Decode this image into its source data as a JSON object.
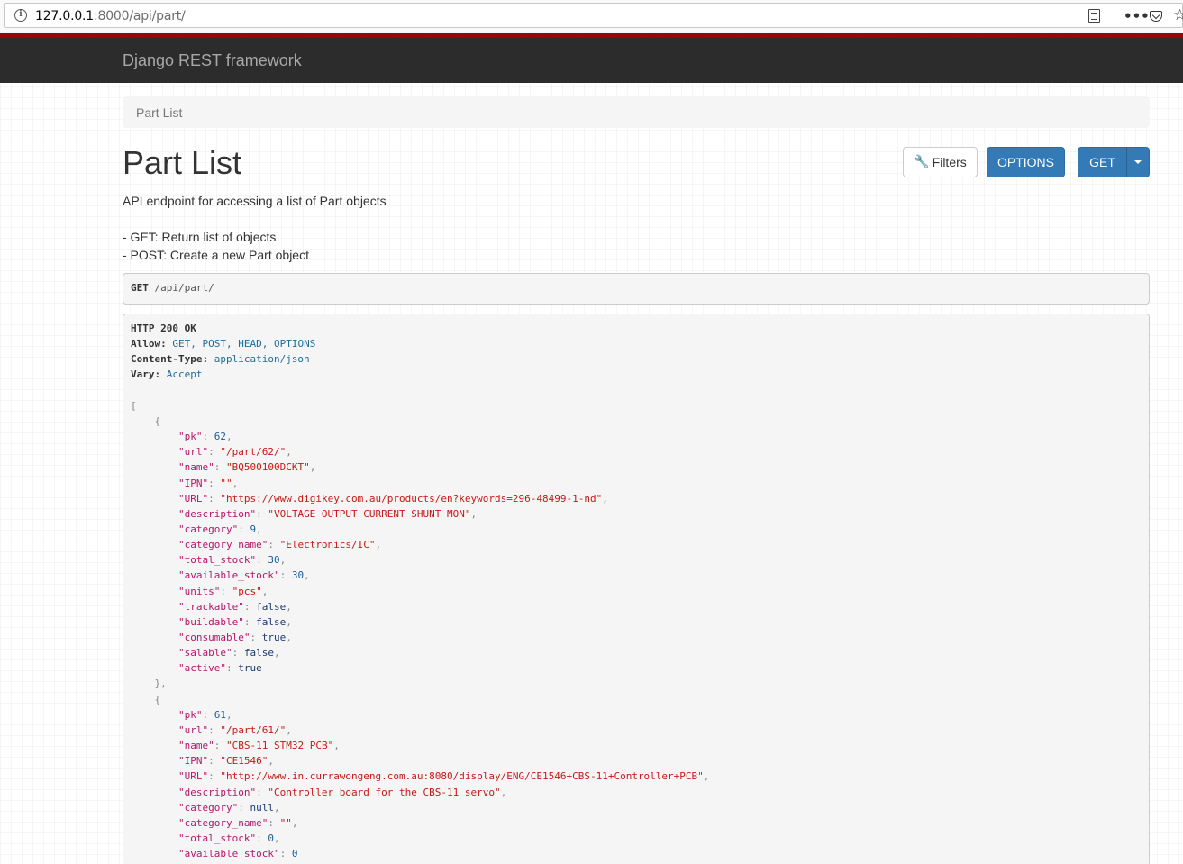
{
  "browser": {
    "url_host": "127.0.0.1",
    "url_path": ":8000/api/part/",
    "icons": [
      "info-icon",
      "reader-view-icon",
      "more-icon",
      "pocket-icon",
      "bookmark-star-icon"
    ]
  },
  "navbar": {
    "brand": "Django REST framework"
  },
  "breadcrumb": {
    "current": "Part List"
  },
  "page": {
    "title": "Part List",
    "description_lines": [
      "API endpoint for accessing a list of Part objects",
      "- GET: Return list of objects",
      "- POST: Create a new Part object"
    ]
  },
  "buttons": {
    "filters": "Filters",
    "options": "OPTIONS",
    "get": "GET"
  },
  "request": {
    "method": "GET",
    "path": "/api/part/"
  },
  "response": {
    "status": "HTTP 200 OK",
    "headers": [
      {
        "key": "Allow",
        "value": "GET, POST, HEAD, OPTIONS"
      },
      {
        "key": "Content-Type",
        "value": "application/json"
      },
      {
        "key": "Vary",
        "value": "Accept"
      }
    ],
    "parts": [
      {
        "fields": [
          {
            "k": "pk",
            "v": "62",
            "t": "num"
          },
          {
            "k": "url",
            "v": "\"/part/62/\"",
            "t": "str"
          },
          {
            "k": "name",
            "v": "\"BQ500100DCKT\"",
            "t": "str"
          },
          {
            "k": "IPN",
            "v": "\"\"",
            "t": "str"
          },
          {
            "k": "URL",
            "v": "\"https://www.digikey.com.au/products/en?keywords=296-48499-1-nd\"",
            "t": "str"
          },
          {
            "k": "description",
            "v": "\"VOLTAGE OUTPUT CURRENT SHUNT MON\"",
            "t": "str"
          },
          {
            "k": "category",
            "v": "9",
            "t": "num"
          },
          {
            "k": "category_name",
            "v": "\"Electronics/IC\"",
            "t": "str"
          },
          {
            "k": "total_stock",
            "v": "30",
            "t": "num"
          },
          {
            "k": "available_stock",
            "v": "30",
            "t": "num"
          },
          {
            "k": "units",
            "v": "\"pcs\"",
            "t": "str"
          },
          {
            "k": "trackable",
            "v": "false",
            "t": "lit"
          },
          {
            "k": "buildable",
            "v": "false",
            "t": "lit"
          },
          {
            "k": "consumable",
            "v": "true",
            "t": "lit"
          },
          {
            "k": "salable",
            "v": "false",
            "t": "lit"
          },
          {
            "k": "active",
            "v": "true",
            "t": "lit"
          }
        ]
      },
      {
        "fields": [
          {
            "k": "pk",
            "v": "61",
            "t": "num"
          },
          {
            "k": "url",
            "v": "\"/part/61/\"",
            "t": "str"
          },
          {
            "k": "name",
            "v": "\"CBS-11 STM32 PCB\"",
            "t": "str"
          },
          {
            "k": "IPN",
            "v": "\"CE1546\"",
            "t": "str"
          },
          {
            "k": "URL",
            "v": "\"http://www.in.currawongeng.com.au:8080/display/ENG/CE1546+CBS-11+Controller+PCB\"",
            "t": "str"
          },
          {
            "k": "description",
            "v": "\"Controller board for the CBS-11 servo\"",
            "t": "str"
          },
          {
            "k": "category",
            "v": "null",
            "t": "lit"
          },
          {
            "k": "category_name",
            "v": "\"\"",
            "t": "str"
          },
          {
            "k": "total_stock",
            "v": "0",
            "t": "num"
          },
          {
            "k": "available_stock",
            "v": "0",
            "t": "num"
          }
        ]
      }
    ]
  }
}
